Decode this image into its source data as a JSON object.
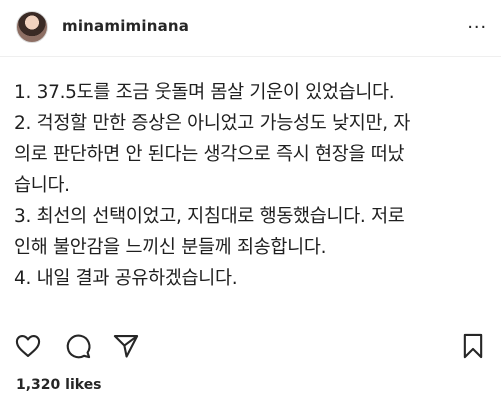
{
  "header": {
    "username": "minamiminana",
    "more_label": "..."
  },
  "post": {
    "lines": [
      "1. 37.5도를 조금 웃돌며 몸살 기운이 있었습니다.",
      "2. 걱정할 만한 증상은 아니었고 가능성도 낮지만, 자",
      "의로 판단하면 안 된다는 생각으로 즉시 현장을 떠났",
      "습니다.",
      "3. 최선의 선택이었고, 지침대로 행동했습니다. 저로",
      "인해 불안감을 느끼신 분들께 죄송합니다.",
      "4. 내일 결과 공유하겠습니다."
    ]
  },
  "actions": {
    "icons": [
      "heart-icon",
      "comment-icon",
      "share-icon",
      "bookmark-icon"
    ]
  },
  "footer": {
    "likes": "1,320 likes"
  }
}
